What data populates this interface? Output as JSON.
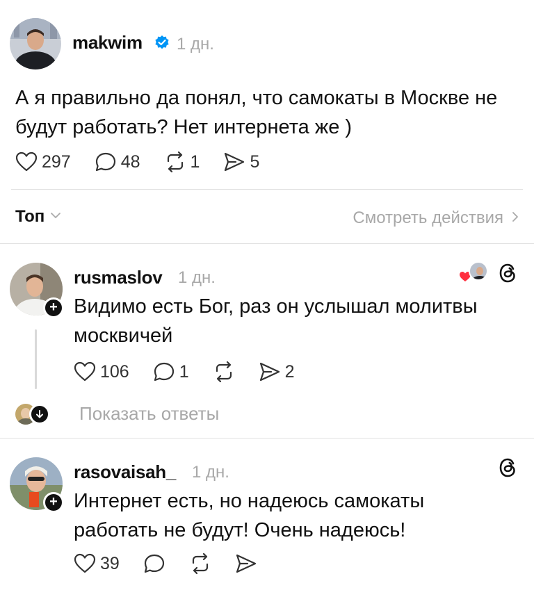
{
  "main_post": {
    "username": "makwim",
    "time": "1 дн.",
    "text_line1": "А я правильно да понял, что самокаты в Москве не",
    "text_line2": "будут работать? Нет интернета же )",
    "likes": "297",
    "comments": "48",
    "reposts": "1",
    "shares": "5"
  },
  "filter": {
    "sort_label": "Топ",
    "activity_label": "Смотреть действия"
  },
  "replies": [
    {
      "username": "rusmaslov",
      "time": "1 дн.",
      "text_line1": "Видимо есть Бог, раз он услышал молитвы",
      "text_line2": "москвичей",
      "likes": "106",
      "comments": "1",
      "shares": "2",
      "show_replies": "Показать ответы"
    },
    {
      "username": "rasovaisah_",
      "time": "1 дн.",
      "text_line1": "Интернет есть, но надеюсь самокаты",
      "text_line2": "работать не будут! Очень надеюсь!",
      "likes": "39"
    }
  ],
  "colors": {
    "text": "#111111",
    "muted": "#a8a8a8",
    "verified": "#0095f6",
    "like_red": "#ff3040"
  },
  "icons": [
    "heart-icon",
    "comment-icon",
    "repost-icon",
    "share-icon",
    "verified-badge-icon",
    "threads-logo-icon",
    "chevron-down-icon",
    "chevron-right-icon",
    "plus-icon"
  ]
}
